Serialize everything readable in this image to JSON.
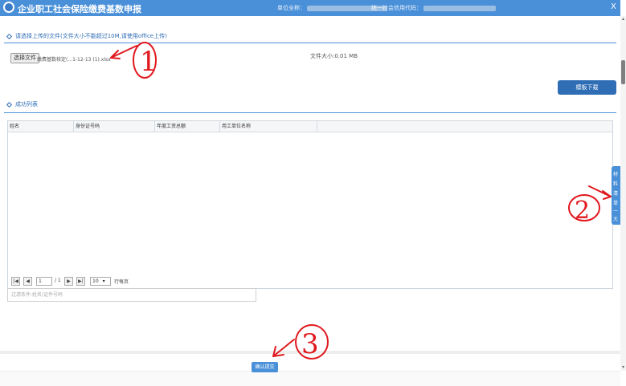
{
  "header": {
    "title": "企业职工社会保险缴费基数申报",
    "unit_name_label": "单位全称：",
    "credit_code_label": "统一社会信用代码：",
    "close_label": "X"
  },
  "upload": {
    "section_title": "请选择上传的文件(文件大小不能超过10M,请使用office上传)",
    "choose_button": "选择文件",
    "file_name": "缴费基数核定(...1-12-13 (1).xlsx",
    "file_size": "文件大小:0.01 MB",
    "template_button": "模板下载"
  },
  "success_list": {
    "section_title": "成功列表",
    "columns": [
      "姓名",
      "身份证号码",
      "年度工资总额",
      "用工单位名称"
    ],
    "pager": {
      "first": "|◀",
      "prev": "◀",
      "page_value": "1",
      "page_total": "/ 1",
      "next": "▶",
      "last": "▶|",
      "page_size": "10",
      "per_page_label": "行每页"
    },
    "filter_placeholder": "过滤条件:姓名/证件号码"
  },
  "submit_button": "确认提交",
  "side_tab": {
    "chars": [
      "材",
      "料",
      "清",
      "单",
      "一",
      "大"
    ]
  },
  "annotations": [
    "1",
    "2",
    "3"
  ],
  "colors": {
    "primary": "#4a90d9",
    "dark_primary": "#2f6db5",
    "annotation": "#e0191f"
  }
}
